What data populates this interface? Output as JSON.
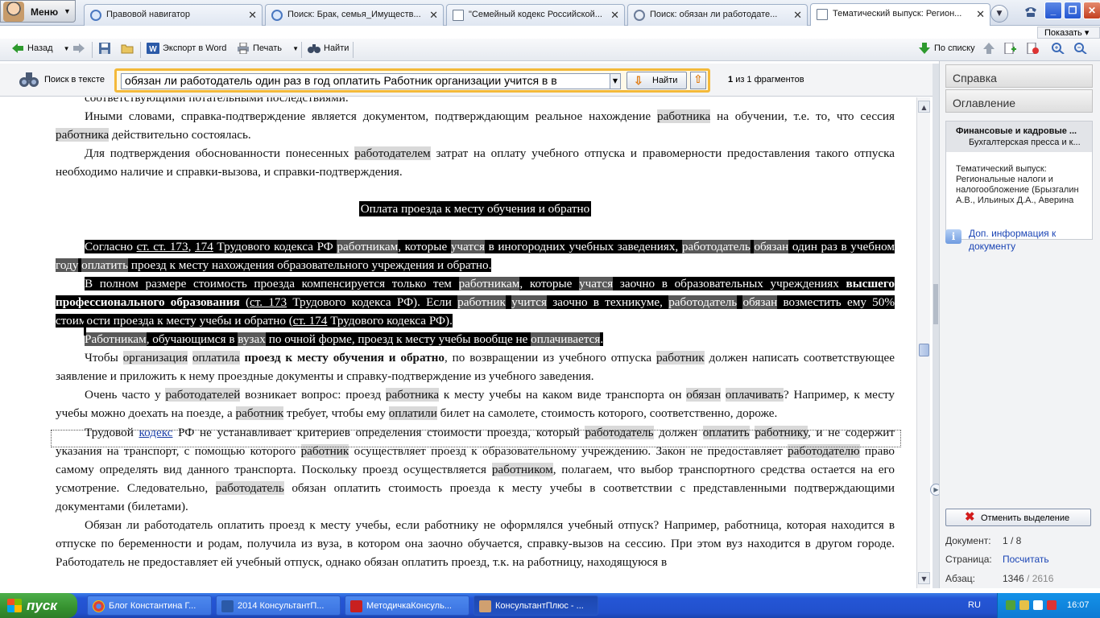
{
  "menu": {
    "label": "Меню"
  },
  "tabs": [
    {
      "label": "Правовой навигатор",
      "icon": "browser-icon"
    },
    {
      "label": "Поиск: Брак, семья_Имуществ...",
      "icon": "browser-icon"
    },
    {
      "label": "\"Семейный кодекс Российской...",
      "icon": "document-icon"
    },
    {
      "label": "Поиск: обязан ли работодате...",
      "icon": "magnifier-icon"
    },
    {
      "label": "Тематический выпуск: Регион...",
      "icon": "document-icon"
    }
  ],
  "toolbar": {
    "back": "Назад",
    "export_word": "Экспорт в Word",
    "print": "Печать",
    "find": "Найти",
    "by_list": "По списку",
    "show": "Показать"
  },
  "search": {
    "label": "Поиск в тексте",
    "query": "обязан ли работодатель один раз в год оплатить  Работник организации учится в в",
    "find_button": "Найти",
    "count_current": "1",
    "count_text": "из 1 фрагментов"
  },
  "document": {
    "top_fragment": "соответствующими потательными последствиями.",
    "p1": {
      "a": "Иными словами, справка-подтверждение является документом, подтверждающим реальное нахождение ",
      "h1": "работника",
      "b": " на обучении, т.е. то, что сессия ",
      "h2": "работника",
      "c": " действительно состоялась."
    },
    "p2": {
      "a": "Для подтверждения обоснованности понесенных ",
      "h1": "работодателем",
      "b": " затрат на оплату учебного отпуска и правомерности предоставления такого отпуска необходимо наличие и справки-вызова, и справки-подтверждения."
    },
    "heading": "Оплата проезда к месту обучения и обратно",
    "p3": {
      "a": "Согласно ",
      "l1": "ст. ст. 173",
      "b": ", ",
      "l2": "174",
      "c": " Трудового кодекса РФ ",
      "h1": "работникам",
      "d": ", которые ",
      "h2": "учатся",
      "e": " в иногородних учебных заведениях, ",
      "h3": "работодатель",
      "f": " ",
      "h4": "обязан",
      "g": " один раз в учебном ",
      "h5": "году",
      "h": " ",
      "h6": "оплатить",
      "i": " проезд к месту нахождения образовательного учреждения и обратно."
    },
    "p4": {
      "a": "В полном размере стоимость проезда компенсируется только тем ",
      "h1": "работникам",
      "b": ", которые ",
      "h2": "учатся",
      "c": " заочно в образовательных учреждениях ",
      "bold": "высшего профессионального образования",
      "d": " (",
      "l1": "ст. 173",
      "e": " Трудового кодекса РФ). Если ",
      "h3": "работник",
      "f": " ",
      "h4": "учится",
      "g": " заочно в техникуме, ",
      "h5": "работодатель",
      "h": " ",
      "h6": "обязан",
      "i": " возместить ему 50% стоимости проезда к месту учебы и обратно (",
      "l2": "ст. 174",
      "j": " Трудового кодекса РФ)."
    },
    "p5": {
      "h1": "Работникам",
      "a": ", обучающимся в ",
      "h2": "вузах",
      "b": " по очной форме, проезд к месту учебы вообще не ",
      "h3": "оплачивается",
      "c": "."
    },
    "p6": {
      "a": "Чтобы ",
      "h1": "организация",
      "b": " ",
      "h2": "оплатила",
      "c": " ",
      "bold": "проезд к месту обучения и обратно",
      "d": ", по возвращении из учебного отпуска ",
      "h3": "работник",
      "e": " должен написать соответствующее заявление и приложить к нему проездные документы и справку-подтверждение из учебного заведения."
    },
    "p7": {
      "a": "Очень часто у ",
      "h1": "работодателей",
      "b": " возникает вопрос: проезд ",
      "h2": "работника",
      "c": " к месту учебы на каком виде транспорта он ",
      "h3": "обязан",
      "d": " ",
      "h4": "оплачивать",
      "e": "? Например, к месту учебы можно доехать на поезде, а ",
      "h5": "работник",
      "f": " требует, чтобы ему ",
      "h6": "оплатили",
      "g": " билет на самолете, стоимость которого, соответственно, дороже."
    },
    "p8": {
      "a": "Трудовой ",
      "l1": "кодекс",
      "b": " РФ не устанавливает критериев определения стоимости проезда, который ",
      "h1": "работодатель",
      "c": " должен ",
      "h2": "оплатить",
      "d": " ",
      "h3": "работнику",
      "e": ", и не содержит указания на транспорт, с помощью которого ",
      "h4": "работник",
      "f": " осуществляет проезд к образовательному учреждению. Закон не предоставляет ",
      "h5": "работодателю",
      "g": " право самому определять вид данного транспорта. Поскольку проезд осуществляется ",
      "h6": "работником",
      "h": ", полагаем, что выбор транспортного средства остается на его усмотрение. Следовательно, ",
      "h7": "работодатель",
      "i": " обязан оплатить стоимость проезда к месту учебы в соответствии с представленными подтверждающими документами (билетами)."
    },
    "p9": {
      "a": "Обязан ли работодатель оплатить проезд к месту учебы, если работнику не оформлялся учебный отпуск? Например, работница, которая находится в отпуске по беременности и родам, получила из вуза, в котором она заочно обучается, справку-вызов на сессию. При этом вуз находится в другом городе. Работодатель не предоставляет ей учебный отпуск, однако обязан оплатить проезд, т.к. на работницу, находящуюся в"
    }
  },
  "right_panel": {
    "tab_help": "Справка",
    "tab_toc": "Оглавление",
    "card_title": "Финансовые и кадровые ...",
    "card_subtitle": "Бухгалтерская пресса и к...",
    "card_body": "Тематический выпуск: Региональные налоги и налогообложение (Брызгалин А.В., Ильиных Д.А., Аверина",
    "info_link": "Доп. информация к документу",
    "unselect_button": "Отменить выделение",
    "doc_label": "Документ:",
    "doc_value": "1 / 8",
    "page_label": "Страница:",
    "page_value": "Посчитать",
    "para_label": "Абзац:",
    "para_value_current": "1346",
    "para_value_total": " / 2616"
  },
  "taskbar": {
    "start": "пуск",
    "items": [
      {
        "label": "Блог Константина Г...",
        "icon": "chrome-icon"
      },
      {
        "label": "2014 КонсультантП...",
        "icon": "word-icon"
      },
      {
        "label": "МетодичкаКонсуль...",
        "icon": "pdf-icon"
      },
      {
        "label": "КонсультантПлюс - ...",
        "icon": "consultant-icon"
      }
    ],
    "lang": "RU",
    "clock": "16:07"
  }
}
